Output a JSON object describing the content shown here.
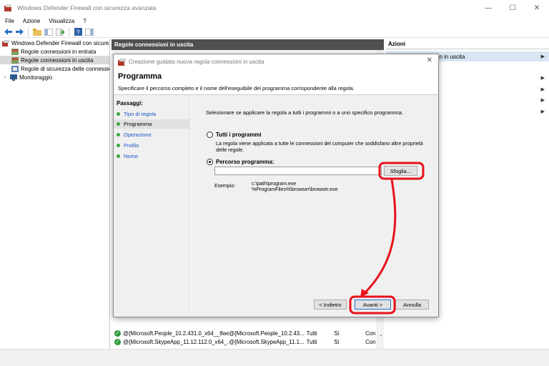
{
  "window": {
    "title": "Windows Defender Firewall con sicurezza avanzata",
    "controls": {
      "minimize": "—",
      "maximize": "☐",
      "close": "✕"
    }
  },
  "menu": {
    "items": [
      "File",
      "Azione",
      "Visualizza",
      "?"
    ]
  },
  "tree": {
    "items": [
      {
        "label": "Windows Defender Firewall con sicurezz",
        "icon": "firewall-icon"
      },
      {
        "label": "Regole connessioni in entrata",
        "icon": "rules-icon"
      },
      {
        "label": "Regole connessioni in uscita",
        "icon": "rules-icon"
      },
      {
        "label": "Regole di sicurezza delle connession",
        "icon": "security-rules-icon"
      },
      {
        "label": "Monitoraggio",
        "icon": "monitor-icon"
      }
    ]
  },
  "center": {
    "header": "Regole connessioni in uscita",
    "rows": [
      {
        "c1": "@{Microsoft.People_10.2.431.0_x64__8we...",
        "c2": "@{Microsoft.People_10.2.43...",
        "c3": "Tutti",
        "c4": "Sì",
        "c5": "Con"
      },
      {
        "c1": "@{Microsoft.SkypeApp_11.12.112.0_x64_...",
        "c2": "@{Microsoft.SkypeApp_11.1...",
        "c3": "Tutti",
        "c4": "Sì",
        "c5": "Con"
      }
    ]
  },
  "actions": {
    "header": "Azioni",
    "first_item": "on in uscita"
  },
  "dialog": {
    "title": "Creazione guidata nuova regola connessioni in uscita",
    "heading": "Programma",
    "subtitle": "Specificare il percorso completo e il nome dell'eseguibile del programma corrispondente alla regola.",
    "steps_title": "Passaggi:",
    "steps": [
      "Tipo di regola",
      "Programma",
      "Operazione",
      "Profilo",
      "Nome"
    ],
    "question": "Selezionare se applicare la regola a tutti i programmi o a uno specifico programma.",
    "option_all": {
      "label": "Tutti i programmi",
      "desc": "La regola viene applicata a tutte le connessioni del computer che soddisfano altre proprietà delle regole."
    },
    "option_path": {
      "label": "Percorso programma:",
      "value": ""
    },
    "browse": "Sfoglia...",
    "example_label": "Esempio:",
    "example_lines": [
      "c:\\path\\program.exe",
      "%ProgramFiles%\\browser\\browser.exe"
    ],
    "back": "< Indietro",
    "next": "Avanti >",
    "cancel": "Annulla"
  },
  "colors": {
    "highlight": "#e8121c",
    "header_dark": "#505050",
    "link": "#1a55c6",
    "step_dot": "#3aa93a"
  }
}
